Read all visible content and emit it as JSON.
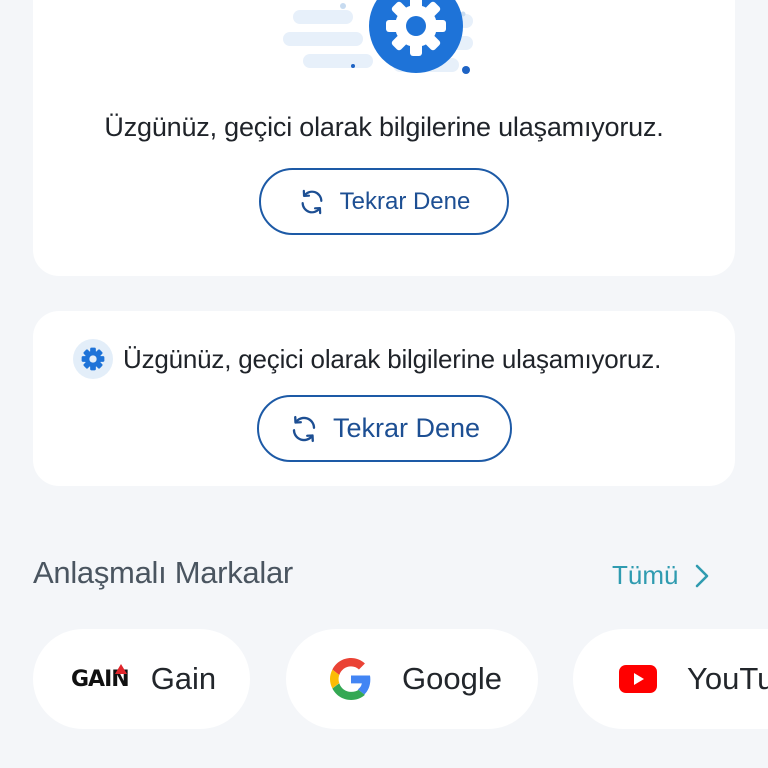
{
  "error_card_large": {
    "message": "Üzgünüz, geçici olarak bilgilerine ulaşamıyoruz.",
    "retry_label": "Tekrar Dene",
    "icon": "gear-icon"
  },
  "error_card_small": {
    "message": "Üzgünüz, geçici olarak bilgilerine ulaşamıyoruz.",
    "retry_label": "Tekrar Dene",
    "icon": "gear-icon"
  },
  "brands_section": {
    "title": "Anlaşmalı Markalar",
    "see_all_label": "Tümü",
    "items": [
      {
        "name": "Gain",
        "logo_text": "GAIN",
        "icon": "gain-logo"
      },
      {
        "name": "Google",
        "icon": "google-logo"
      },
      {
        "name": "YouTube",
        "icon": "youtube-logo"
      }
    ]
  },
  "colors": {
    "primary": "#1d5aa6",
    "accent_link": "#2f9bb0",
    "background": "#f4f6f9",
    "card": "#ffffff"
  }
}
